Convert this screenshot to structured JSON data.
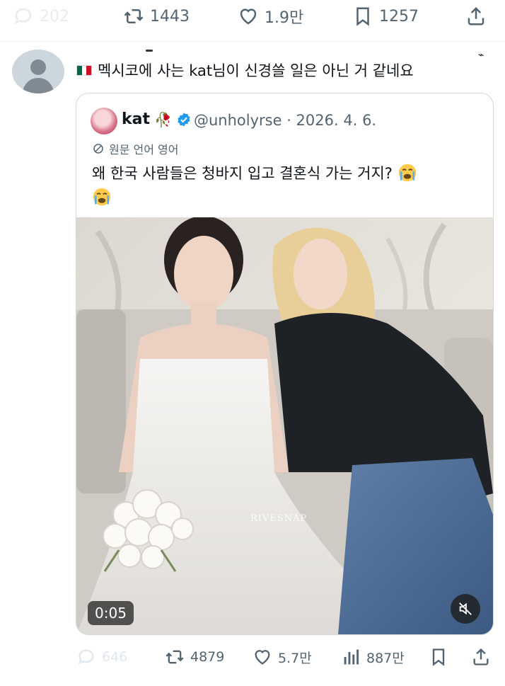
{
  "top_actions": {
    "replies": "202",
    "retweets": "1443",
    "likes": "1.9만",
    "bookmarks": "1257"
  },
  "reply": {
    "flag_icon": "mexico-flag-icon",
    "text": "멕시코에 사는 kat님이 신경쓸 일은 아닌 거 같네요"
  },
  "quote": {
    "name": "kat",
    "name_decoration": "rose-icon",
    "handle_date": "@unholyrse · 2026. 4. 6.",
    "language_note": "원문 언어 영어",
    "text": "왜 한국 사람들은 청바지 입고 결혼식 가는 거지?",
    "emoji": "loudly-crying-face-icon",
    "video": {
      "timestamp": "0:05",
      "watermark": "RIVESNAP"
    }
  },
  "bottom_actions": {
    "replies": "646",
    "retweets": "4879",
    "likes": "5.7만",
    "views": "887만"
  },
  "colors": {
    "text": "#0f1419",
    "secondary": "#536471",
    "border": "#cfd9de",
    "verified": "#1d9bf0"
  }
}
